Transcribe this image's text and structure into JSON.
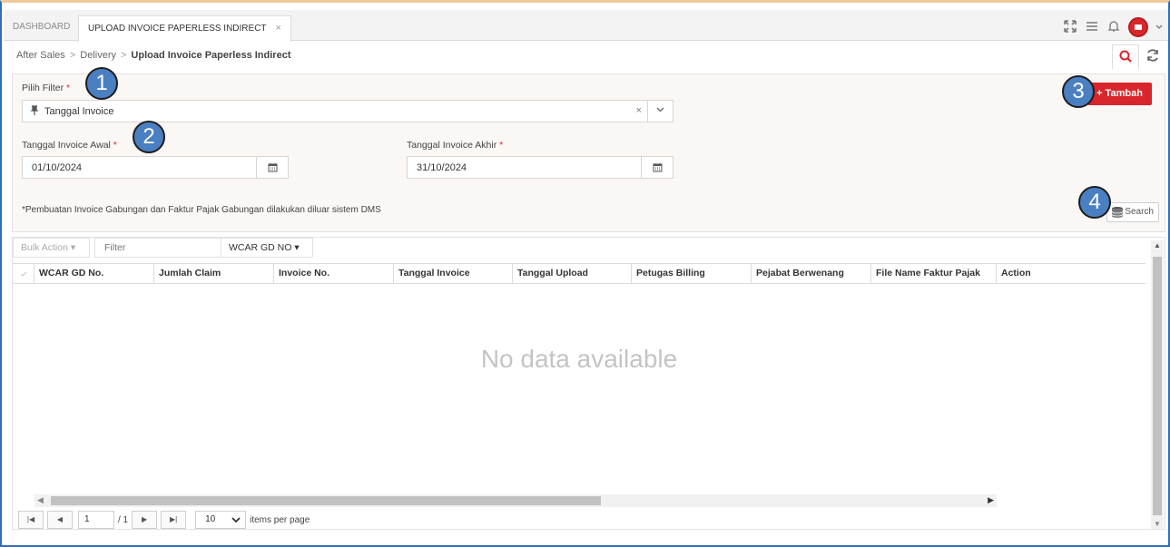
{
  "tabs": [
    {
      "label": "DASHBOARD"
    },
    {
      "label": "UPLOAD INVOICE PAPERLESS INDIRECT",
      "close": "×"
    }
  ],
  "breadcrumb": {
    "items": [
      "After Sales",
      "Delivery"
    ],
    "current": "Upload Invoice Paperless Indirect",
    "sep": ">"
  },
  "filter": {
    "pilih_label": "Pilih Filter",
    "required_mark": "*",
    "selected": "Tanggal Invoice",
    "clear": "×",
    "awal_label": "Tanggal Invoice Awal",
    "awal_value": "01/10/2024",
    "akhir_label": "Tanggal Invoice Akhir",
    "akhir_value": "31/10/2024",
    "note": "*Pembuatan Invoice Gabungan dan Faktur Pajak Gabungan dilakukan diluar sistem DMS",
    "tambah_label": "+ Tambah",
    "search_label": "Search"
  },
  "bubbles": [
    "1",
    "2",
    "3",
    "4"
  ],
  "grid": {
    "bulk_action": "Bulk Action ▾",
    "filter_placeholder": "Filter",
    "column_select": "WCAR GD NO ▾",
    "columns": [
      "WCAR GD No.",
      "Jumlah Claim",
      "Invoice No.",
      "Tanggal Invoice",
      "Tanggal Upload",
      "Petugas Billing",
      "Pejabat Berwenang",
      "File Name Faktur Pajak",
      "Action"
    ],
    "empty_text": "No data available"
  },
  "pager": {
    "page": "1",
    "of": "/ 1",
    "page_size": "10",
    "items_per_page": "items per page"
  },
  "colors": {
    "accent": "#d9262c",
    "bubble": "#4a7fc1",
    "border": "#2f6fb3"
  }
}
